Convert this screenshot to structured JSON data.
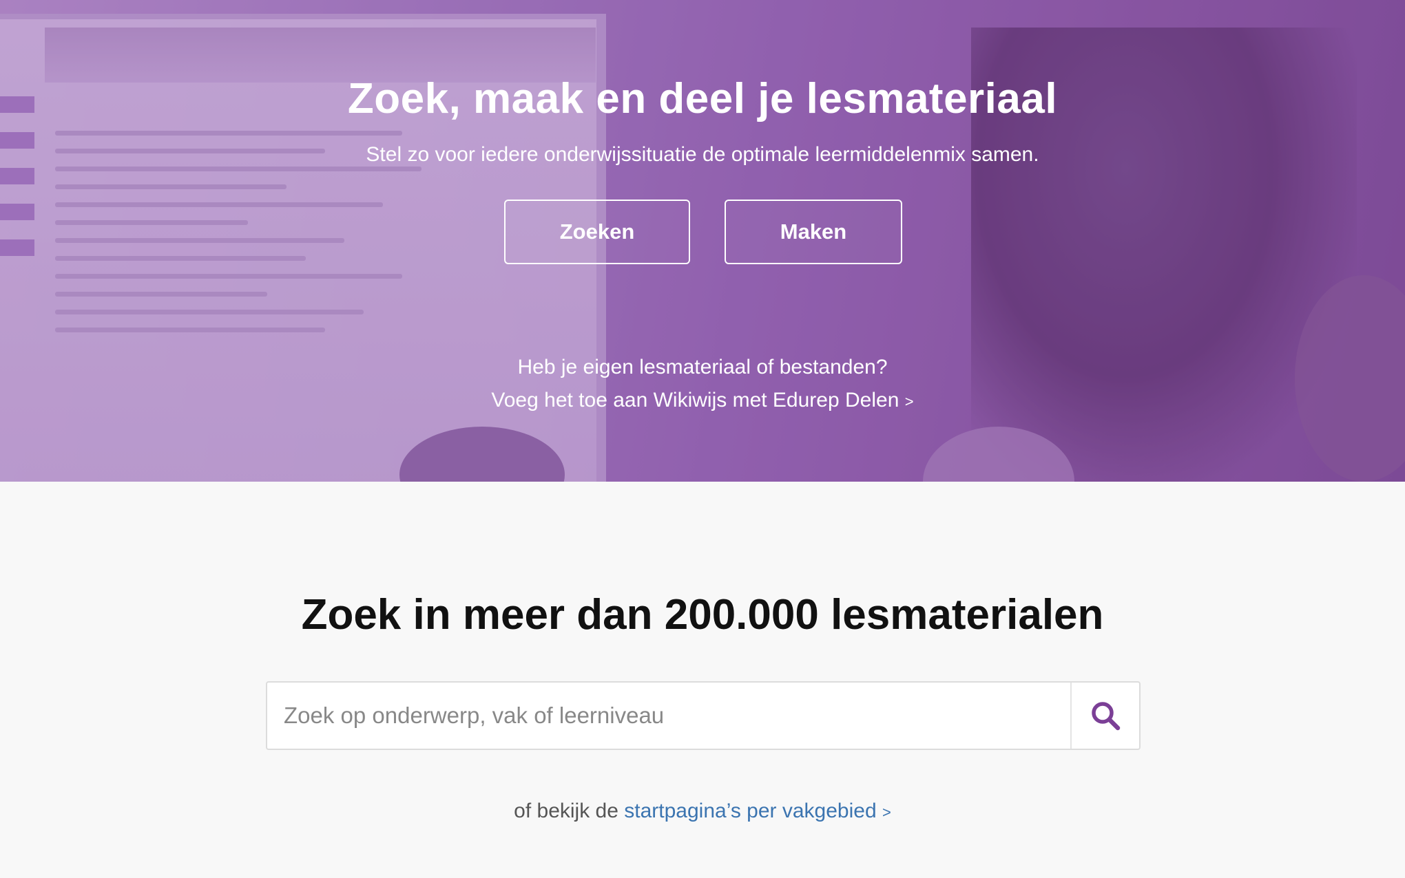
{
  "hero": {
    "title": "Zoek, maak en deel je lesmateriaal",
    "subtitle": "Stel zo voor iedere onderwijssituatie de optimale leermiddelenmix samen.",
    "buttons": {
      "search_label": "Zoeken",
      "make_label": "Maken"
    },
    "own_material": {
      "line1": "Heb je eigen lesmateriaal of bestanden?",
      "link": "Voeg het toe aan Wikiwijs met Edurep Delen",
      "chevron": ">"
    }
  },
  "search": {
    "title": "Zoek in meer dan 200.000 lesmaterialen",
    "placeholder": "Zoek op onderwerp, vak of leerniveau",
    "button_icon": "search-icon",
    "alt_prefix": "of bekijk de",
    "alt_link": "startpagina’s per vakgebied",
    "alt_chevron": ">"
  },
  "colors": {
    "accent_purple": "#7b3f96",
    "link_blue": "#3b74b0",
    "hero_overlay": "#9467ae"
  }
}
